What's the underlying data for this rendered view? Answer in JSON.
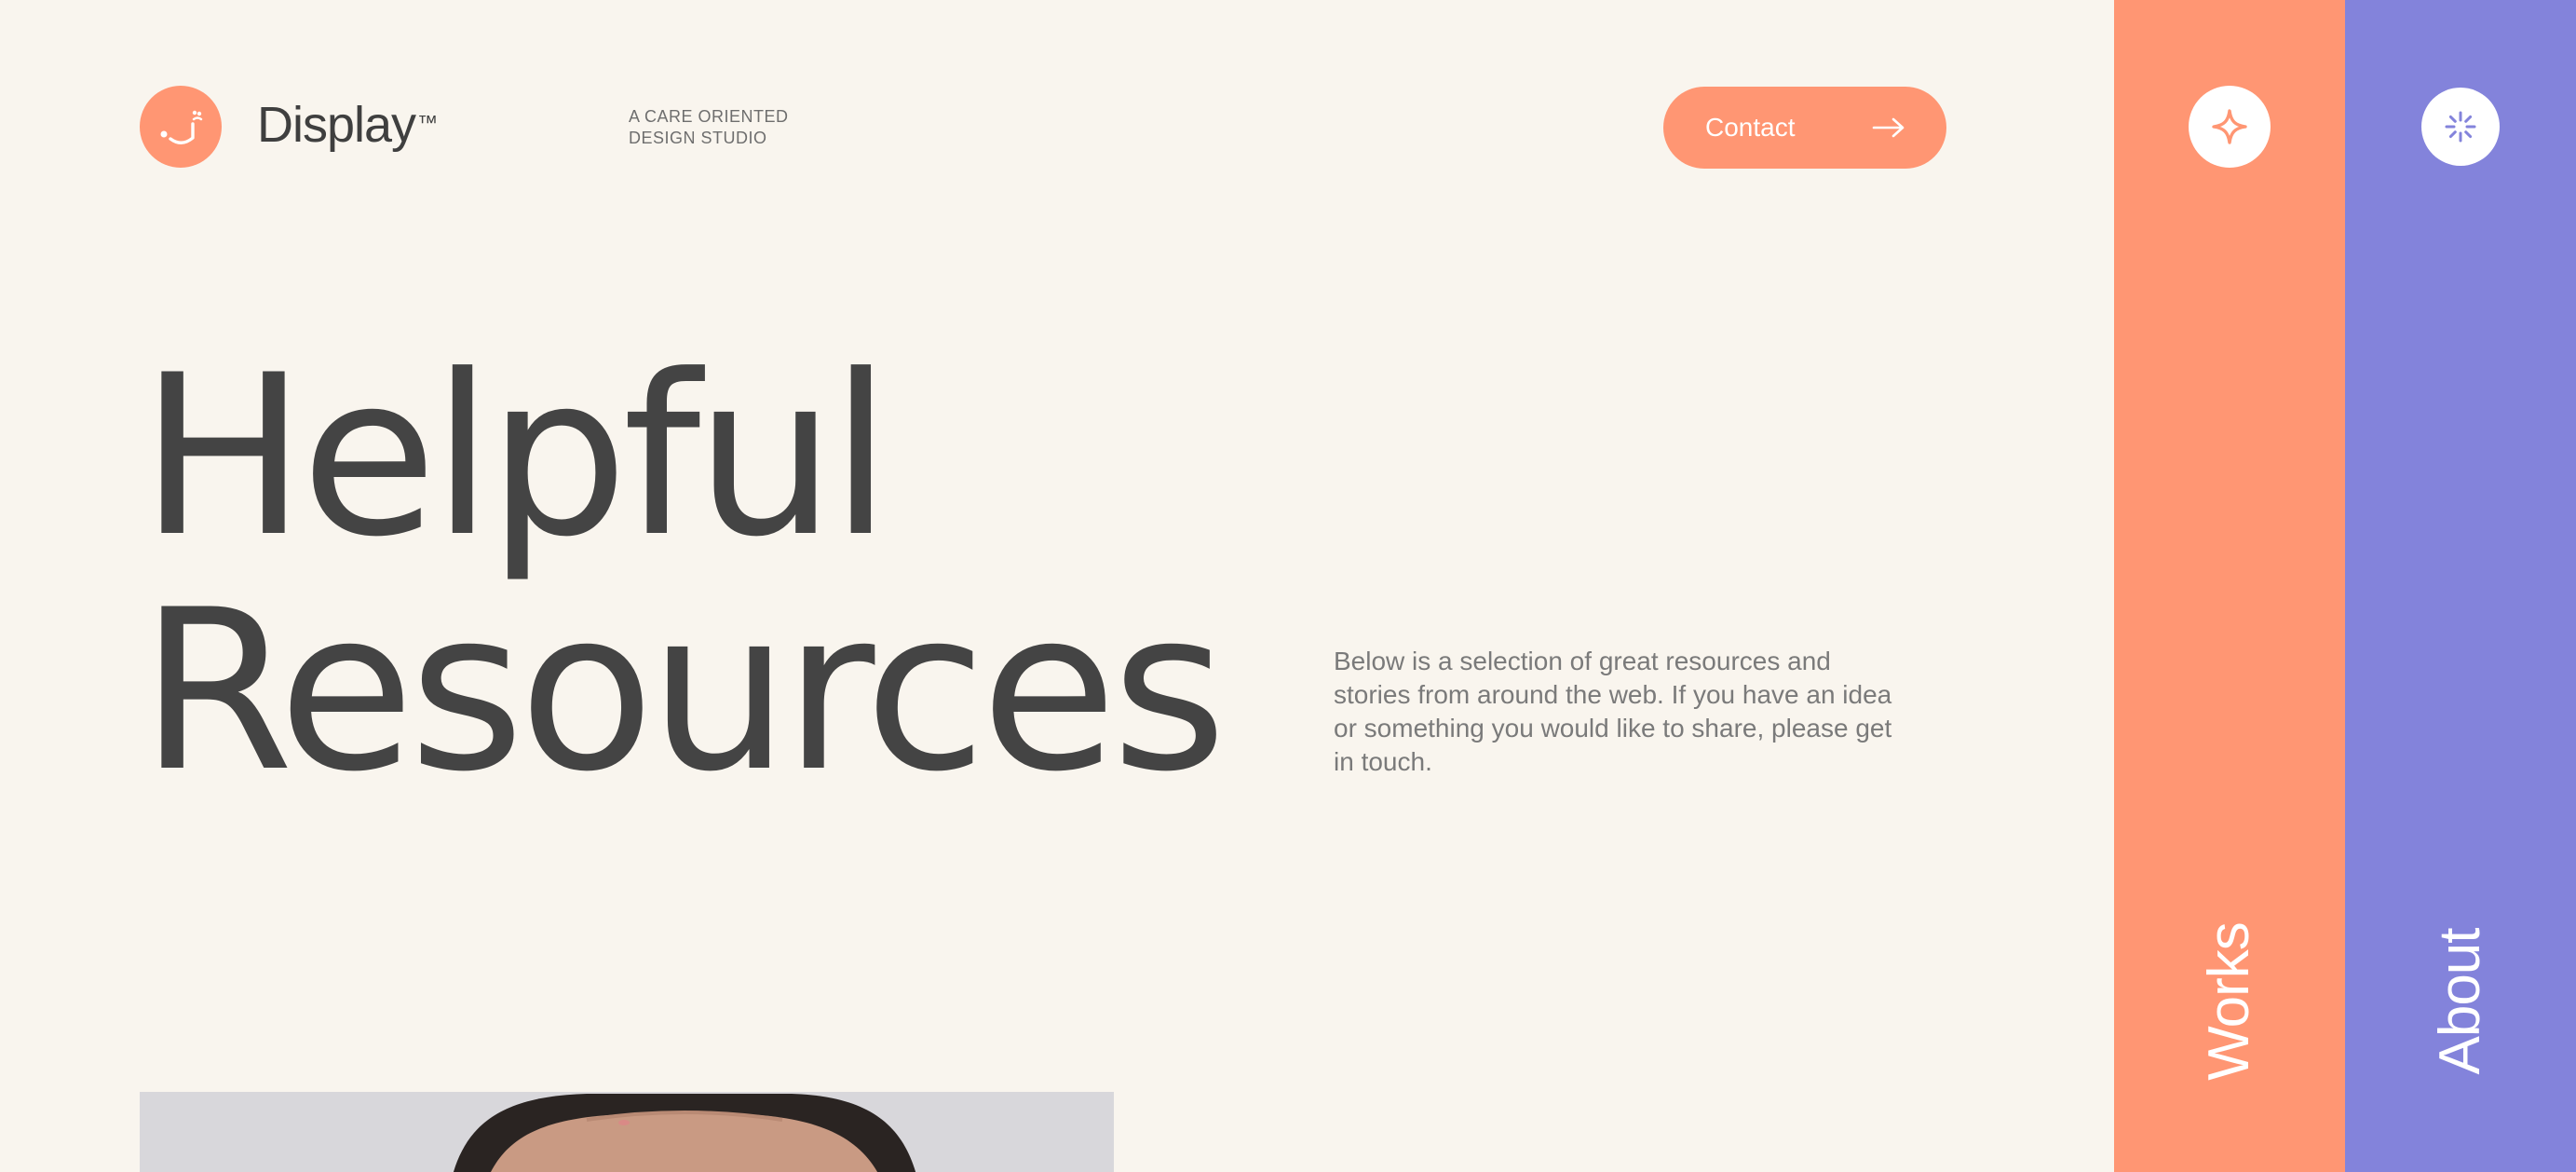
{
  "brand": {
    "name": "Display",
    "trademark": "™",
    "tagline_line1": "A CARE ORIENTED",
    "tagline_line2": "DESIGN STUDIO",
    "logo_icon": "smiley-face-icon"
  },
  "header": {
    "contact_label": "Contact",
    "contact_icon": "arrow-right-icon"
  },
  "hero": {
    "title_line1": "Helpful",
    "title_line2": "Resources",
    "intro": "Below is a selection of great resources and stories from around the web. If you have an idea or something you would like to share, please get in touch."
  },
  "side_nav": {
    "works": {
      "label": "Works",
      "icon": "sparkle-icon",
      "color": "#ff9673"
    },
    "about": {
      "label": "About",
      "icon": "loader-burst-icon",
      "color": "#8383db"
    }
  },
  "colors": {
    "background": "#f9f5ee",
    "accent": "#ff9673",
    "secondary": "#8383db",
    "text": "#444444"
  }
}
